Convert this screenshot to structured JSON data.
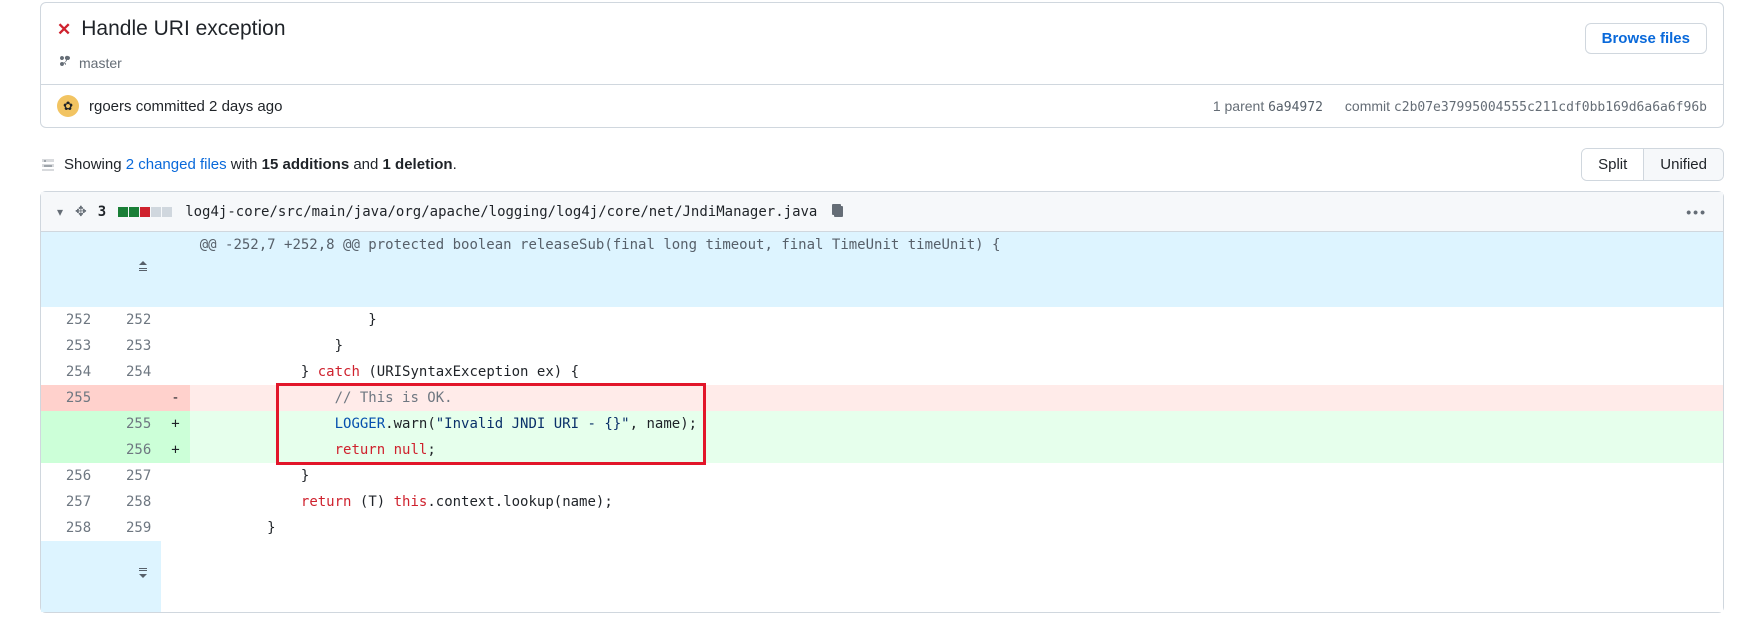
{
  "commit": {
    "status_glyph": "✕",
    "title": "Handle URI exception",
    "branch": "master",
    "browse_label": "Browse files",
    "author": "rgoers",
    "committed_text": "committed 2 days ago",
    "avatar_glyph": "✿",
    "parent_label": "1 parent",
    "parent_sha": "6a94972",
    "sha_label": "commit",
    "commit_sha": "c2b07e37995004555c211cdf0bb169d6a6a6f96b"
  },
  "toolbar": {
    "showing": "Showing ",
    "changed_files": "2 changed files",
    "with": " with ",
    "adds": "15 additions",
    "and": " and ",
    "dels": "1 deletion",
    "dot": ".",
    "split": "Split",
    "unified": "Unified"
  },
  "file": {
    "chevron": "▾",
    "change_count": "3",
    "path": "log4j-core/src/main/java/org/apache/logging/log4j/core/net/JndiManager.java",
    "kebab": "•••"
  },
  "hunk_header": "@@ -252,7 +252,8 @@ protected boolean releaseSub(final long timeout, final TimeUnit timeUnit) {",
  "diff": [
    {
      "l": "252",
      "r": "252",
      "sign": " ",
      "kind": "ctx",
      "html": "                    }"
    },
    {
      "l": "253",
      "r": "253",
      "sign": " ",
      "kind": "ctx",
      "html": "                }"
    },
    {
      "l": "254",
      "r": "254",
      "sign": " ",
      "kind": "ctx",
      "html": "            } <span class='k'>catch</span> (URISyntaxException ex) {"
    },
    {
      "l": "255",
      "r": "",
      "sign": "-",
      "kind": "del",
      "html": "                <span class='c'>// This is OK.</span>"
    },
    {
      "l": "",
      "r": "255",
      "sign": "+",
      "kind": "add",
      "html": "                <span class='n'>LOGGER</span>.warn(<span class='s'>\"Invalid JNDI URI - {}\"</span>, name);"
    },
    {
      "l": "",
      "r": "256",
      "sign": "+",
      "kind": "add",
      "html": "                <span class='k'>return</span> <span class='k'>null</span>;"
    },
    {
      "l": "256",
      "r": "257",
      "sign": " ",
      "kind": "ctx",
      "html": "            }"
    },
    {
      "l": "257",
      "r": "258",
      "sign": " ",
      "kind": "ctx",
      "html": "            <span class='k'>return</span> (T) <span class='k'>this</span>.context.lookup(name);"
    },
    {
      "l": "258",
      "r": "259",
      "sign": " ",
      "kind": "ctx",
      "html": "        }"
    }
  ]
}
